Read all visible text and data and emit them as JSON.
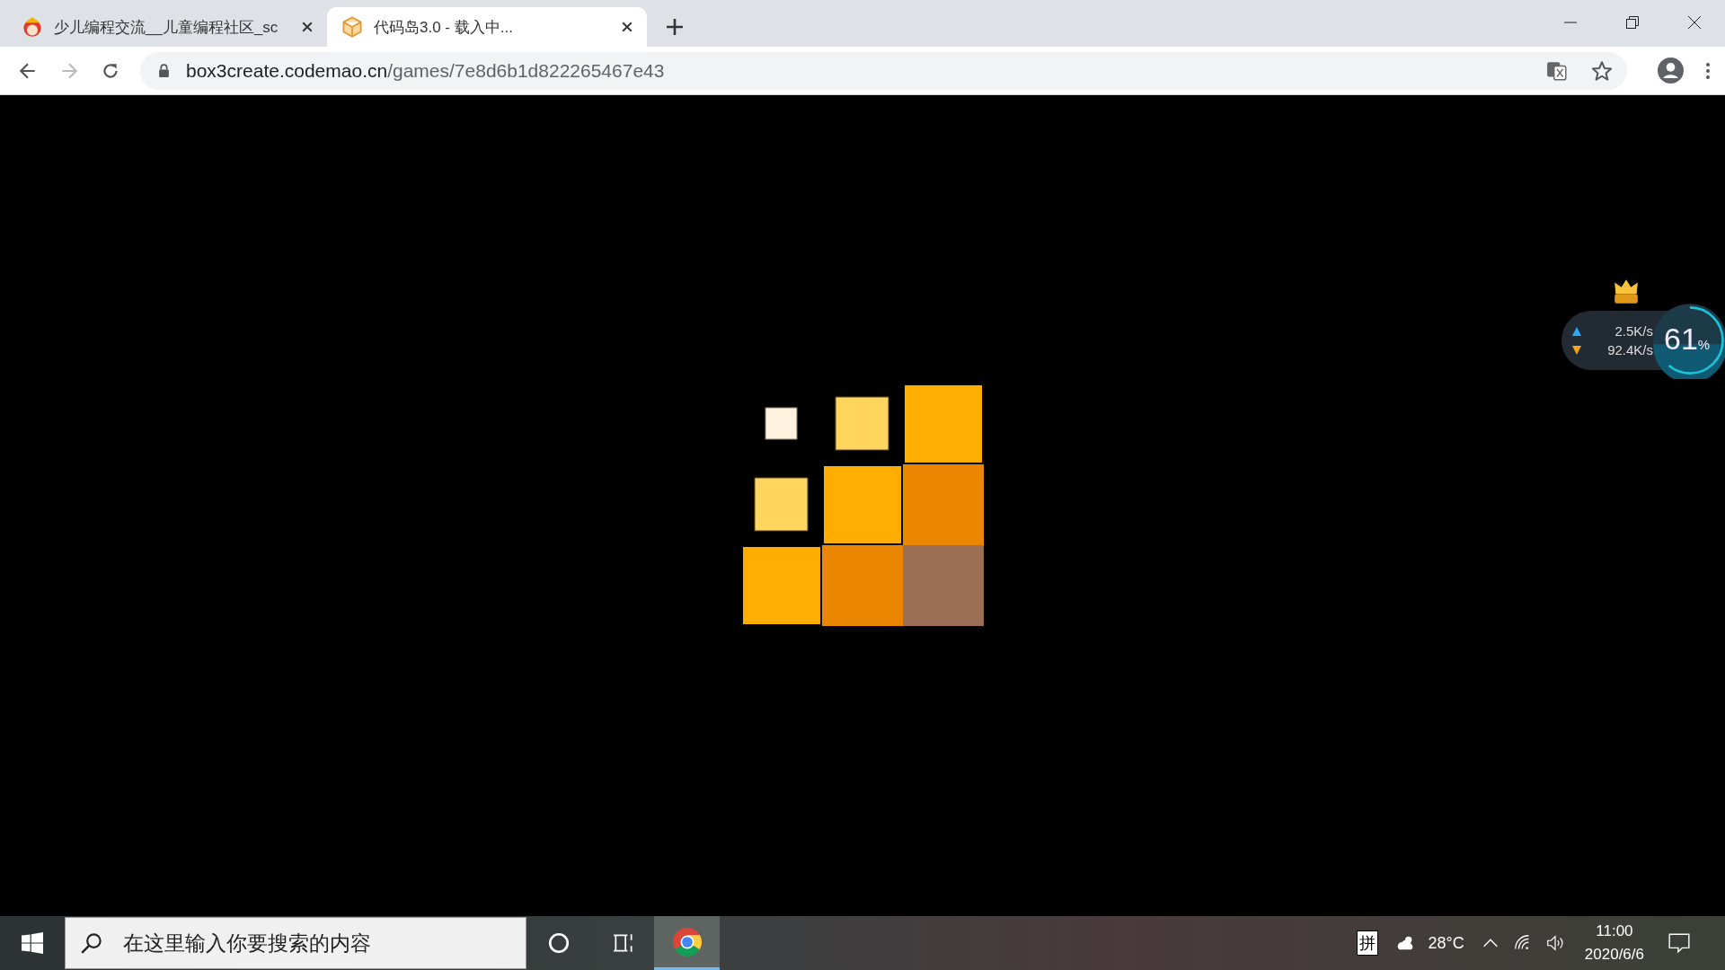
{
  "tabs": [
    {
      "title": "少儿编程交流__儿童编程社区_sc",
      "selected": false,
      "kind": "mascot"
    },
    {
      "title": "代码岛3.0 - 载入中...",
      "selected": true,
      "kind": "cube"
    }
  ],
  "address_bar": {
    "domain": "box3create.codemao.cn",
    "path": "/games/7e8d6b1d822265467e43"
  },
  "speed_widget": {
    "upload": "2.5K/s",
    "download": "92.4K/s",
    "percent": "61",
    "unit": "%",
    "level": 0.61
  },
  "taskbar": {
    "search_placeholder": "在这里输入你要搜索的内容",
    "ime": "拼",
    "temperature": "28°C",
    "time": "11:00",
    "date": "2020/6/6"
  }
}
